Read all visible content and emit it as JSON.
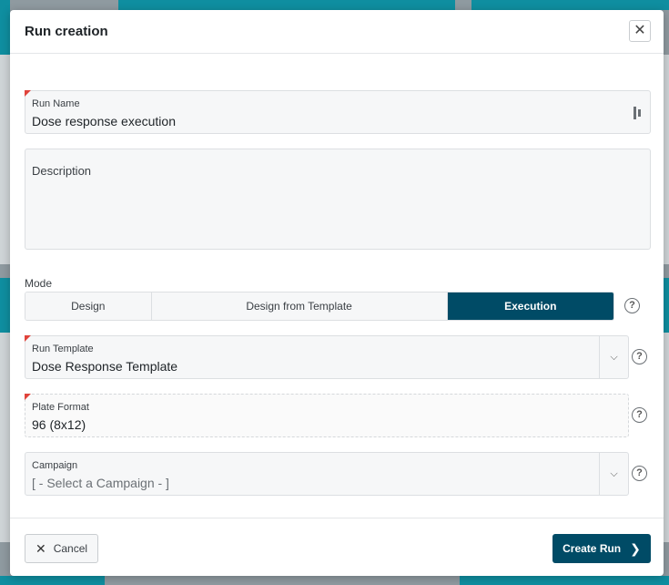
{
  "modal": {
    "title": "Run creation",
    "close_icon": "close-icon"
  },
  "fields": {
    "run_name": {
      "label": "Run Name",
      "value": "Dose response execution",
      "icon": "field-options-icon",
      "required": true
    },
    "description": {
      "label": "Description",
      "value": ""
    },
    "run_template": {
      "label": "Run Template",
      "value": "Dose Response Template",
      "required": true
    },
    "plate_format": {
      "label": "Plate Format",
      "value": "96 (8x12)",
      "required": true
    },
    "campaign": {
      "label": "Campaign",
      "placeholder": "[ - Select a Campaign - ]"
    }
  },
  "mode": {
    "label": "Mode",
    "options": [
      "Design",
      "Design from Template",
      "Execution"
    ],
    "selected": "Execution"
  },
  "help_glyph": "?",
  "footer": {
    "cancel_label": "Cancel",
    "create_label": "Create Run"
  },
  "colors": {
    "primary": "#004b66",
    "required_marker": "#e0433b",
    "background_card": "#0f8ea0"
  }
}
